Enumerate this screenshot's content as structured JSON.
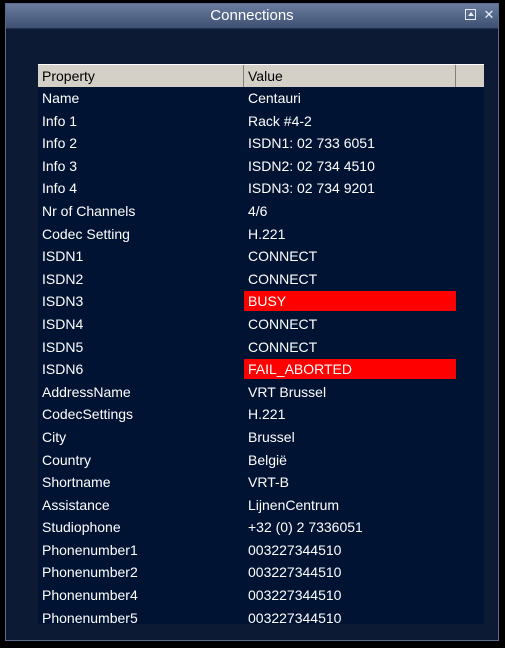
{
  "window": {
    "title": "Connections"
  },
  "table": {
    "headers": {
      "property": "Property",
      "value": "Value"
    },
    "rows": [
      {
        "property": "Name",
        "value": "Centauri"
      },
      {
        "property": "Info 1",
        "value": "Rack #4-2"
      },
      {
        "property": "Info 2",
        "value": "ISDN1: 02 733 6051"
      },
      {
        "property": "Info 3",
        "value": "ISDN2: 02 734 4510"
      },
      {
        "property": "Info 4",
        "value": "ISDN3: 02 734 9201"
      },
      {
        "property": "Nr of Channels",
        "value": "4/6"
      },
      {
        "property": "Codec Setting",
        "value": "H.221"
      },
      {
        "property": "ISDN1",
        "value": "CONNECT"
      },
      {
        "property": "ISDN2",
        "value": "CONNECT"
      },
      {
        "property": "ISDN3",
        "value": "BUSY",
        "highlight": "#ff0000"
      },
      {
        "property": "ISDN4",
        "value": "CONNECT"
      },
      {
        "property": "ISDN5",
        "value": "CONNECT"
      },
      {
        "property": "ISDN6",
        "value": "FAIL_ABORTED",
        "highlight": "#ff0000"
      },
      {
        "property": "AddressName",
        "value": "VRT Brussel"
      },
      {
        "property": "CodecSettings",
        "value": "H.221"
      },
      {
        "property": "City",
        "value": "Brussel"
      },
      {
        "property": "Country",
        "value": "België"
      },
      {
        "property": "Shortname",
        "value": "VRT-B"
      },
      {
        "property": "Assistance",
        "value": "LijnenCentrum"
      },
      {
        "property": "Studiophone",
        "value": "+32 (0) 2 7336051"
      },
      {
        "property": "Phonenumber1",
        "value": "003227344510"
      },
      {
        "property": "Phonenumber2",
        "value": "003227344510"
      },
      {
        "property": "Phonenumber4",
        "value": "003227344510"
      },
      {
        "property": "Phonenumber5",
        "value": "003227344510"
      }
    ]
  }
}
